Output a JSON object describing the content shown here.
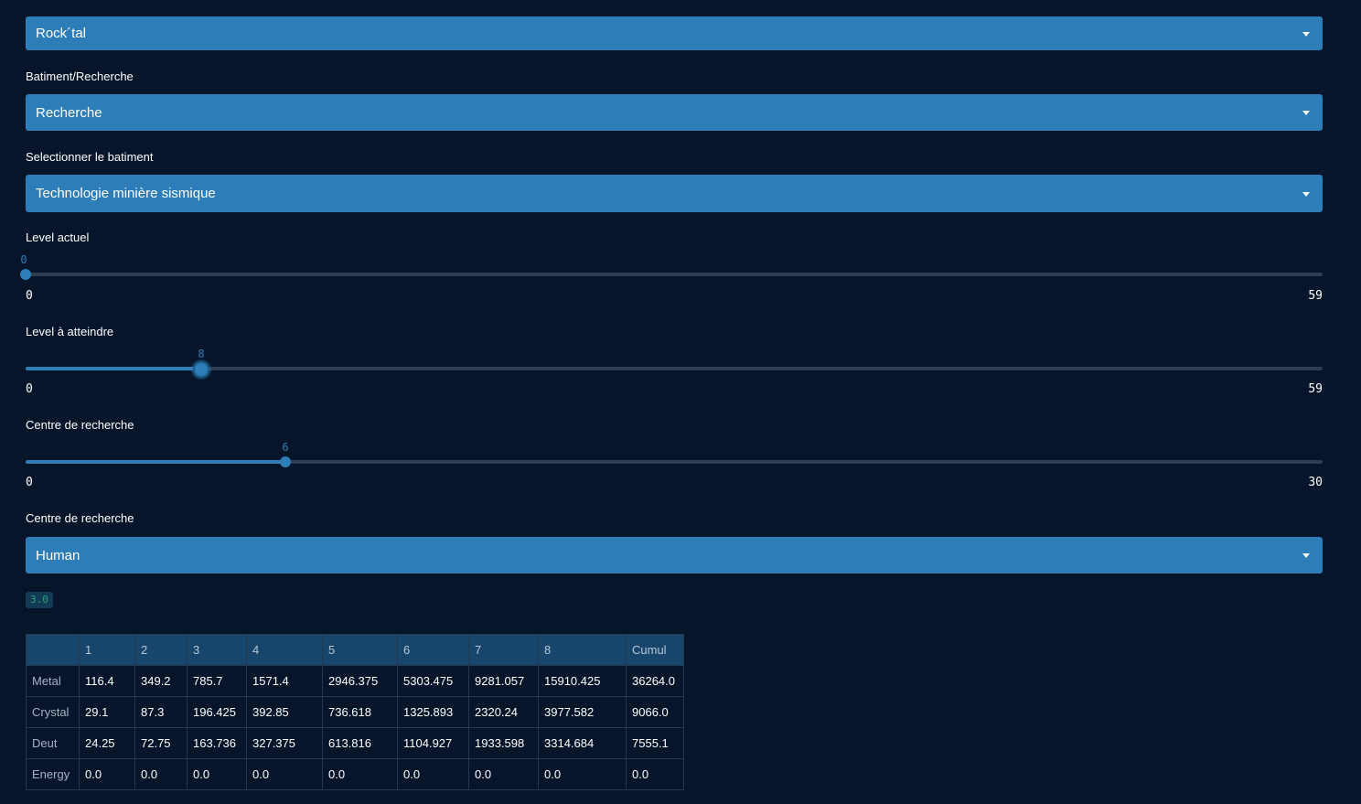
{
  "select_race": {
    "value": "Rock´tal"
  },
  "building_type": {
    "label": "Batiment/Recherche",
    "value": "Recherche"
  },
  "building": {
    "label": "Selectionner le batiment",
    "value": "Technologie minière sismique"
  },
  "level_current": {
    "label": "Level actuel",
    "value": "0",
    "min": "0",
    "max": "59"
  },
  "level_target": {
    "label": "Level à atteindre",
    "value": "8",
    "min": "0",
    "max": "59"
  },
  "research_center": {
    "label": "Centre de recherche",
    "value": "6",
    "min": "0",
    "max": "30"
  },
  "research_center_race": {
    "label": "Centre de recherche",
    "value": "Human"
  },
  "result_badge": "3.0",
  "table": {
    "columns": [
      "",
      "1",
      "2",
      "3",
      "4",
      "5",
      "6",
      "7",
      "8",
      "Cumul"
    ],
    "rows": [
      {
        "label": "Metal",
        "values": [
          "116.4",
          "349.2",
          "785.7",
          "1571.4",
          "2946.375",
          "5303.475",
          "9281.057",
          "15910.425",
          "36264.0"
        ]
      },
      {
        "label": "Crystal",
        "values": [
          "29.1",
          "87.3",
          "196.425",
          "392.85",
          "736.618",
          "1325.893",
          "2320.24",
          "3977.582",
          "9066.0"
        ]
      },
      {
        "label": "Deut",
        "values": [
          "24.25",
          "72.75",
          "163.736",
          "327.375",
          "613.816",
          "1104.927",
          "1933.598",
          "3314.684",
          "7555.1"
        ]
      },
      {
        "label": "Energy",
        "values": [
          "0.0",
          "0.0",
          "0.0",
          "0.0",
          "0.0",
          "0.0",
          "0.0",
          "0.0",
          "0.0"
        ]
      }
    ]
  },
  "colors": {
    "background": "#061529",
    "accent": "#2d7db8",
    "track": "#2f3f52",
    "table_header": "#17456b"
  }
}
